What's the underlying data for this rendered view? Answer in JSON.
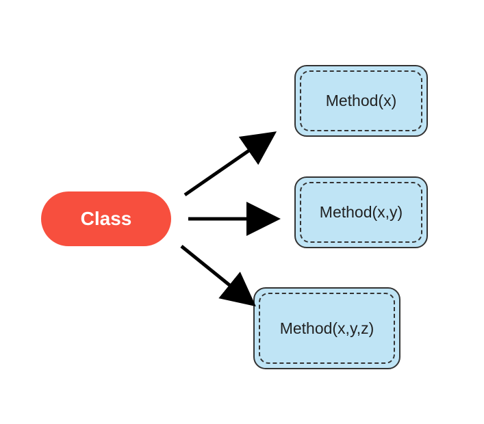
{
  "source": {
    "label": "Class"
  },
  "methods": [
    {
      "label": "Method(x)"
    },
    {
      "label": "Method(x,y)"
    },
    {
      "label": "Method(x,y,z)"
    }
  ]
}
